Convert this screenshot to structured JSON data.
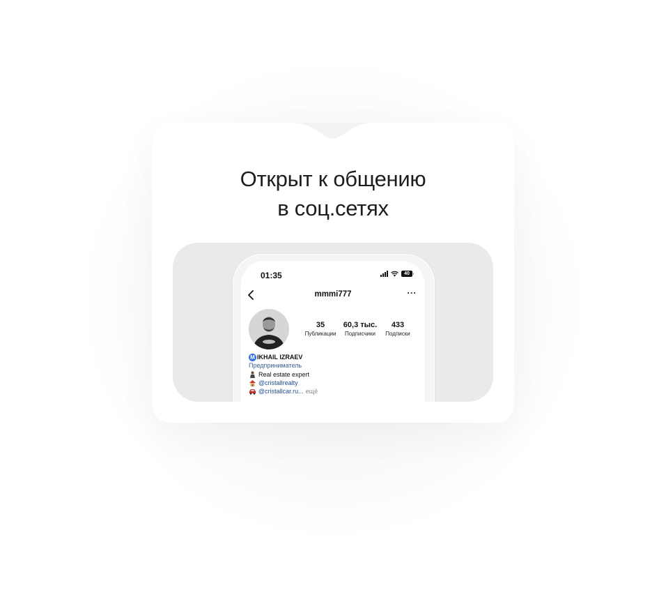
{
  "card": {
    "title_line1": "Открыт к общению",
    "title_line2": "в соц.сетях"
  },
  "phone": {
    "status": {
      "time": "01:35",
      "battery": "40"
    },
    "header": {
      "username": "mmmi777",
      "back_icon": "chevron-left-icon",
      "more_icon": "ellipsis-icon",
      "more_label": "···"
    },
    "profile": {
      "stats": [
        {
          "value": "35",
          "label": "Публикации"
        },
        {
          "value": "60,3 тыс.",
          "label": "Подписчики"
        },
        {
          "value": "433",
          "label": "Подписки"
        }
      ],
      "badge_letter": "M",
      "name": "IKHAIL IZRAEV",
      "category": "Предприниматель",
      "bio_lines": [
        {
          "icon": "person-emoji-icon",
          "text": "Real estate expert"
        },
        {
          "icon": "house-emoji-icon",
          "text": "@cristallrealty"
        },
        {
          "icon": "car-emoji-icon",
          "text": "@cristallcar.ru..."
        }
      ],
      "more_text": "ещё"
    }
  },
  "colors": {
    "panel_bg": "#e8eaeb",
    "link": "#1f4c8f",
    "badge": "#2f6fe0"
  }
}
